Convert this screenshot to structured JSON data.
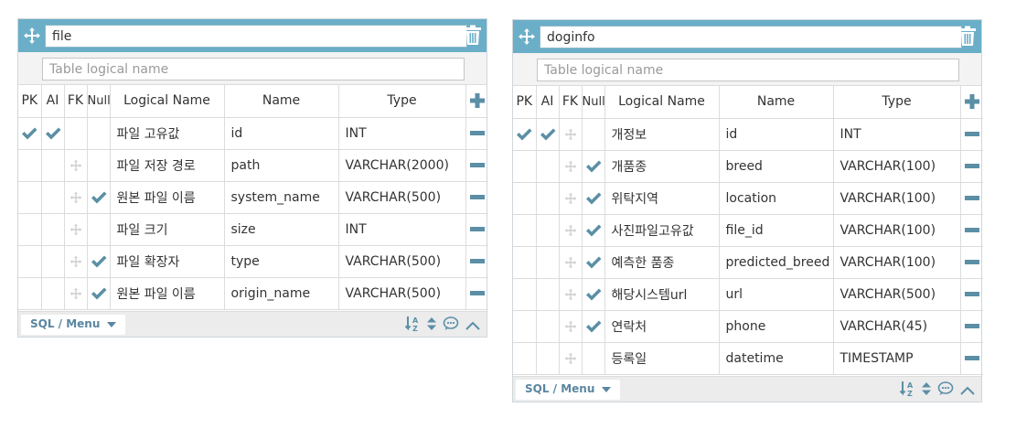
{
  "tables": [
    {
      "name": "file",
      "logical_name_placeholder": "Table logical name",
      "headers": {
        "pk": "PK",
        "ai": "AI",
        "fk": "FK",
        "null": "Null",
        "logical": "Logical Name",
        "name": "Name",
        "type": "Type"
      },
      "footer_menu": "SQL / Menu",
      "rows": [
        {
          "pk": true,
          "ai": true,
          "fk": false,
          "null": false,
          "logical": "파일 고유값",
          "name": "id",
          "type": "INT"
        },
        {
          "pk": false,
          "ai": false,
          "fk": true,
          "null": false,
          "logical": "파일 저장 경로",
          "name": "path",
          "type": "VARCHAR(2000)"
        },
        {
          "pk": false,
          "ai": false,
          "fk": true,
          "null": true,
          "logical": "원본 파일 이름",
          "name": "system_name",
          "type": "VARCHAR(500)"
        },
        {
          "pk": false,
          "ai": false,
          "fk": true,
          "null": false,
          "logical": "파일 크기",
          "name": "size",
          "type": "INT"
        },
        {
          "pk": false,
          "ai": false,
          "fk": true,
          "null": true,
          "logical": "파일 확장자",
          "name": "type",
          "type": "VARCHAR(500)"
        },
        {
          "pk": false,
          "ai": false,
          "fk": true,
          "null": true,
          "logical": "원본 파일 이름",
          "name": "origin_name",
          "type": "VARCHAR(500)"
        }
      ]
    },
    {
      "name": "doginfo",
      "logical_name_placeholder": "Table logical name",
      "headers": {
        "pk": "PK",
        "ai": "AI",
        "fk": "FK",
        "null": "Null",
        "logical": "Logical Name",
        "name": "Name",
        "type": "Type"
      },
      "footer_menu": "SQL / Menu",
      "rows": [
        {
          "pk": true,
          "ai": true,
          "fk": true,
          "null": false,
          "logical": "개정보",
          "name": "id",
          "type": "INT"
        },
        {
          "pk": false,
          "ai": false,
          "fk": true,
          "null": true,
          "logical": "개품종",
          "name": "breed",
          "type": "VARCHAR(100)"
        },
        {
          "pk": false,
          "ai": false,
          "fk": true,
          "null": true,
          "logical": "위탁지역",
          "name": "location",
          "type": "VARCHAR(100)"
        },
        {
          "pk": false,
          "ai": false,
          "fk": true,
          "null": true,
          "logical": "사진파일고유값",
          "name": "file_id",
          "type": "VARCHAR(100)"
        },
        {
          "pk": false,
          "ai": false,
          "fk": true,
          "null": true,
          "logical": "예측한 품종",
          "name": "predicted_breed",
          "type": "VARCHAR(100)"
        },
        {
          "pk": false,
          "ai": false,
          "fk": true,
          "null": true,
          "logical": "해당시스템url",
          "name": "url",
          "type": "VARCHAR(500)"
        },
        {
          "pk": false,
          "ai": false,
          "fk": true,
          "null": true,
          "logical": "연락처",
          "name": "phone",
          "type": "VARCHAR(45)"
        },
        {
          "pk": false,
          "ai": false,
          "fk": true,
          "null": false,
          "logical": "등록일",
          "name": "datetime",
          "type": "TIMESTAMP"
        }
      ]
    }
  ],
  "colors": {
    "header": "#6aaec8",
    "check": "#5b8fa6",
    "move": "#cfcfcf",
    "footer": "#ececec"
  },
  "icons": {
    "move": "move-arrows-icon",
    "trash": "trash-icon",
    "add": "plus-icon",
    "remove": "minus-icon",
    "sort": "sort-az-icon",
    "updown": "up-down-icon",
    "comment": "comment-icon",
    "collapse": "chevron-up-icon"
  }
}
